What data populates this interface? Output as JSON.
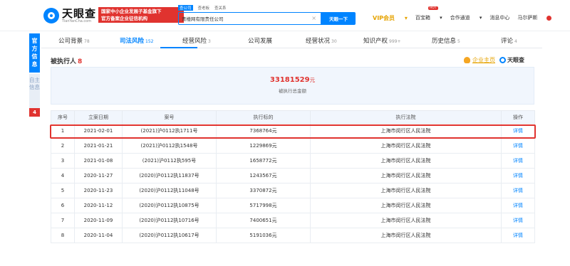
{
  "header": {
    "logo_cn": "天眼查",
    "logo_en": "TianYanCha.com",
    "promo_line1": "国家中小企业发展子基金旗下",
    "promo_line2": "官方备案企业征信机构",
    "search_tabs": [
      "查公司",
      "查老板",
      "查关系"
    ],
    "search_value": "青楼网有限责任公司",
    "search_clear": "×",
    "search_button": "天眼一下",
    "vip_label": "VIP会员",
    "hot_badge": "HOT",
    "links": [
      "百宝箱",
      "合作通道",
      "消息中心"
    ],
    "user_name": "马尔萨斯"
  },
  "side_tabs": {
    "official": "官方信息",
    "self": "自主信息",
    "self_count": "4"
  },
  "category_tabs": [
    {
      "label": "公司背景",
      "count": "78"
    },
    {
      "label": "司法风险",
      "count": "152"
    },
    {
      "label": "经营风险",
      "count": "3"
    },
    {
      "label": "公司发展",
      "count": ""
    },
    {
      "label": "经营状况",
      "count": "30"
    },
    {
      "label": "知识产权",
      "count": "999+"
    },
    {
      "label": "历史信息",
      "count": "5"
    },
    {
      "label": "评论",
      "count": "4"
    }
  ],
  "section": {
    "title": "被执行人",
    "count": "8",
    "link": "企业主页",
    "brand": "天眼查"
  },
  "summary": {
    "amount": "33181529",
    "unit": "元",
    "desc": "被执行总金额"
  },
  "table": {
    "headers": [
      "序号",
      "立案日期",
      "案号",
      "执行标的",
      "执行法院",
      "操作"
    ],
    "rows": [
      [
        "1",
        "2021-02-01",
        "(2021)沪0112执1711号",
        "7368764元",
        "上海市闵行区人民法院",
        "详情"
      ],
      [
        "2",
        "2021-01-21",
        "(2021)沪0112执1548号",
        "1229869元",
        "上海市闵行区人民法院",
        "详情"
      ],
      [
        "3",
        "2021-01-08",
        "(2021)沪0112执595号",
        "1658772元",
        "上海市闵行区人民法院",
        "详情"
      ],
      [
        "4",
        "2020-11-27",
        "(2020)沪0112执11837号",
        "1243567元",
        "上海市闵行区人民法院",
        "详情"
      ],
      [
        "5",
        "2020-11-23",
        "(2020)沪0112执11048号",
        "3370872元",
        "上海市闵行区人民法院",
        "详情"
      ],
      [
        "6",
        "2020-11-12",
        "(2020)沪0112执10875号",
        "5717998元",
        "上海市闵行区人民法院",
        "详情"
      ],
      [
        "7",
        "2020-11-09",
        "(2020)沪0112执10716号",
        "7400651元",
        "上海市闵行区人民法院",
        "详情"
      ],
      [
        "8",
        "2020-11-04",
        "(2020)沪0112执10617号",
        "5191036元",
        "上海市闵行区人民法院",
        "详情"
      ]
    ]
  },
  "colors": {
    "accent": "#0084ff",
    "danger": "#e0332f",
    "vip": "#e6a300"
  }
}
